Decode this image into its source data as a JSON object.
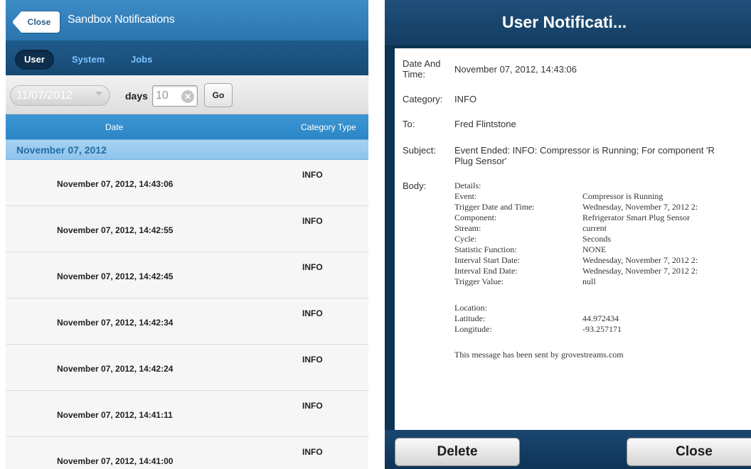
{
  "left": {
    "topbar": {
      "close_label": "Close",
      "title": "Sandbox Notifications"
    },
    "tabs": [
      {
        "label": "User"
      },
      {
        "label": "System"
      },
      {
        "label": "Jobs"
      }
    ],
    "filter": {
      "date_value": "11/07/2012",
      "days_label": "days",
      "days_value": "10",
      "go_label": "Go"
    },
    "columns": {
      "date": "Date",
      "category": "Category Type"
    },
    "group_label": "November 07, 2012",
    "rows": [
      {
        "date": "November 07, 2012, 14:43:06",
        "category": "INFO"
      },
      {
        "date": "November 07, 2012, 14:42:55",
        "category": "INFO"
      },
      {
        "date": "November 07, 2012, 14:42:45",
        "category": "INFO"
      },
      {
        "date": "November 07, 2012, 14:42:34",
        "category": "INFO"
      },
      {
        "date": "November 07, 2012, 14:42:24",
        "category": "INFO"
      },
      {
        "date": "November 07, 2012, 14:41:11",
        "category": "INFO"
      },
      {
        "date": "November 07, 2012, 14:41:00",
        "category": "INFO"
      }
    ]
  },
  "right": {
    "title": "User Notificati...",
    "fields": {
      "date_label_1": "Date And",
      "date_label_2": "Time:",
      "date_value": "November 07, 2012, 14:43:06",
      "category_label": "Category:",
      "category_value": "INFO",
      "to_label": "To:",
      "to_value": "Fred Flintstone",
      "subject_label": "Subject:",
      "subject_value_1": "Event Ended: INFO: Compressor is Running; For component 'R",
      "subject_value_2": "Plug Sensor'",
      "body_label": "Body:"
    },
    "body": {
      "details_heading": "Details:",
      "details": [
        {
          "key": "Event:",
          "value": "Compressor is Running"
        },
        {
          "key": "Trigger Date and Time:",
          "value": "Wednesday, November 7, 2012 2:"
        },
        {
          "key": "Component:",
          "value": "Refrigerator Smart Plug Sensor"
        },
        {
          "key": "Stream:",
          "value": "current"
        },
        {
          "key": "Cycle:",
          "value": "Seconds"
        },
        {
          "key": "Statistic Function:",
          "value": "NONE"
        },
        {
          "key": "Interval Start Date:",
          "value": "Wednesday, November 7, 2012 2:"
        },
        {
          "key": "Interval End Date:",
          "value": "Wednesday, November 7, 2012 2:"
        },
        {
          "key": "Trigger Value:",
          "value": "null"
        }
      ],
      "location_heading": "Location:",
      "location": [
        {
          "key": "Latitude:",
          "value": "44.972434"
        },
        {
          "key": "Longitude:",
          "value": "-93.257171"
        }
      ],
      "footer_note": "This message has been sent by grovestreams.com"
    },
    "buttons": {
      "delete_label": "Delete",
      "close_label": "Close"
    }
  }
}
